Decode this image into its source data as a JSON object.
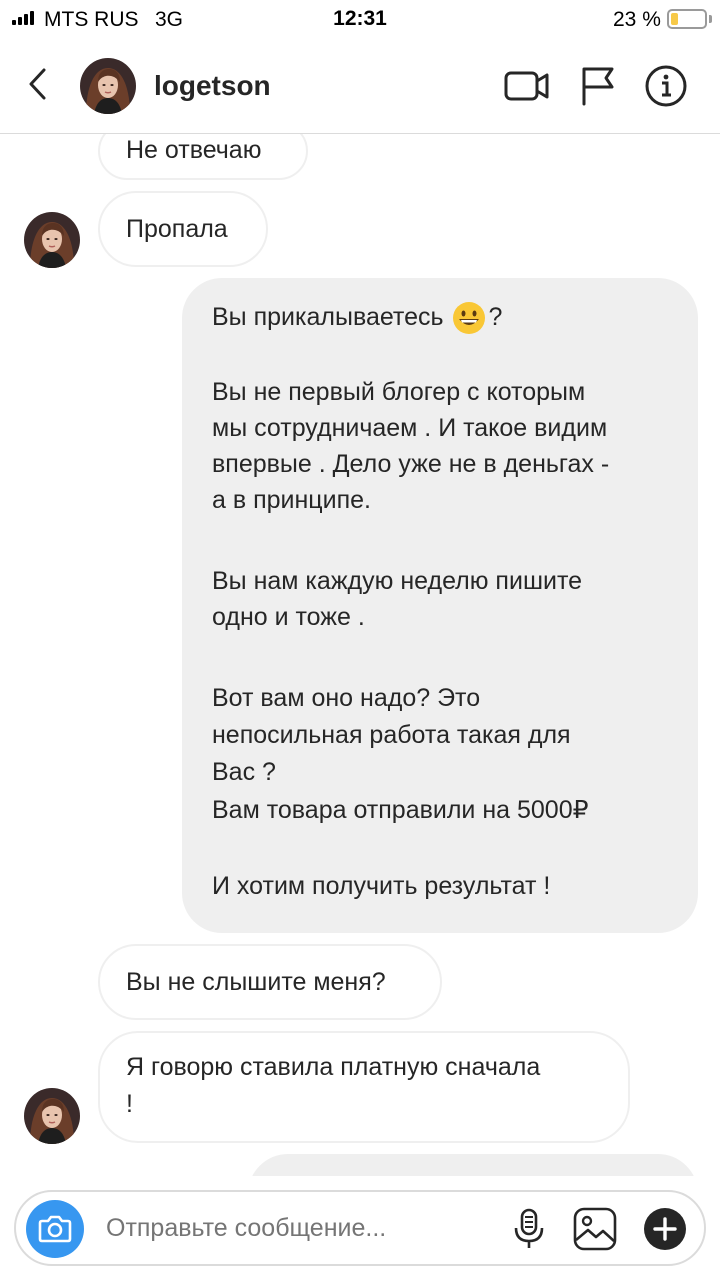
{
  "status_bar": {
    "carrier": "MTS RUS",
    "network": "3G",
    "time": "12:31",
    "battery_percent": "23 %",
    "battery_level": 0.23
  },
  "header": {
    "username": "logetson",
    "icons": [
      "back-chevron-icon",
      "video-call-icon",
      "flag-icon",
      "info-icon"
    ]
  },
  "messages": [
    {
      "side": "in",
      "text": "Не отвечаю"
    },
    {
      "side": "in",
      "text": "Пропала"
    },
    {
      "side": "out",
      "lines": [
        "Вы прикалываетесь ",
        "?",
        "Вы не первый блогер с которым",
        "мы сотрудничаем . И такое видим",
        "впервые . Дело уже не в деньгах -",
        "а в принципе.",
        "Вы нам каждую неделю пишите",
        "одно и тоже .",
        "Вот вам оно надо? Это",
        "непосильная работа такая для",
        "Вас ?",
        "Вам товара отправили на 5000₽",
        "И хотим получить результат !"
      ],
      "emoji": "grinning-face-emoji"
    },
    {
      "side": "in",
      "text": "Вы не слышите меня?"
    },
    {
      "side": "in",
      "lines": [
        "Я говорю ставила платную сначала",
        "!"
      ]
    }
  ],
  "composer": {
    "placeholder": "Отправьте сообщение...",
    "icons": [
      "camera-icon",
      "microphone-icon",
      "gallery-icon",
      "plus-icon"
    ]
  },
  "colors": {
    "accent": "#3797f0",
    "outgoing_bubble": "#efefef",
    "incoming_border": "#efefef",
    "battery_fill": "#f7c948",
    "text": "#262626",
    "placeholder": "#8e8e8e"
  }
}
